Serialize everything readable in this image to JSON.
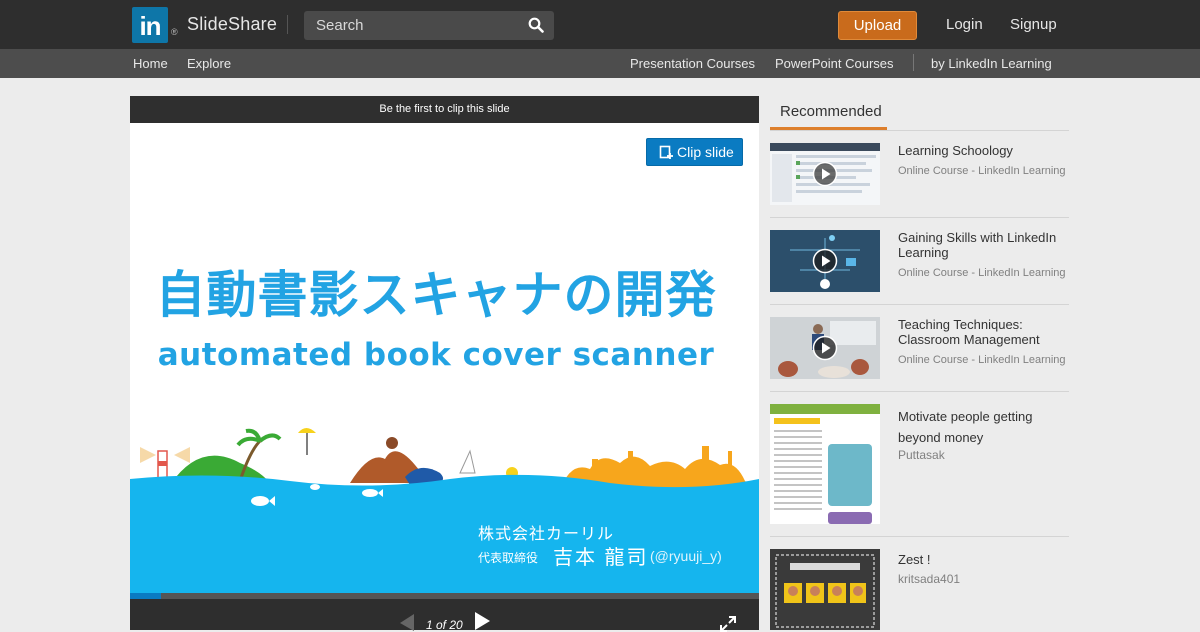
{
  "header": {
    "logo_mark": "in",
    "logo_reg": "®",
    "brand": "SlideShare",
    "search_placeholder": "Search",
    "upload": "Upload",
    "login": "Login",
    "signup": "Signup"
  },
  "nav": {
    "home": "Home",
    "explore": "Explore",
    "presentation_courses": "Presentation Courses",
    "powerpoint_courses": "PowerPoint Courses",
    "by_linkedin": "by LinkedIn Learning"
  },
  "player": {
    "clip_notice": "Be the first to clip this slide",
    "clip_button": "Clip slide",
    "slide": {
      "title_jp": "自動書影スキャナの開発",
      "title_en": "automated book cover scanner",
      "company": "株式会社カーリル",
      "rep_role": "代表取締役",
      "rep_name": "吉本 龍司",
      "rep_handle": "(@ryuuji_y)"
    },
    "progress": 0.05,
    "pager": "1 of 20"
  },
  "sidebar": {
    "tab": "Recommended",
    "items": [
      {
        "title": "Learning Schoology",
        "sub": "Online Course - LinkedIn Learning"
      },
      {
        "title": "Gaining Skills with LinkedIn Learning",
        "sub": "Online Course - LinkedIn Learning"
      },
      {
        "title": "Teaching Techniques: Classroom Management",
        "sub": "Online Course - LinkedIn Learning"
      },
      {
        "title": "Motivate people getting beyond money",
        "sub": "Puttasak"
      },
      {
        "title": "Zest !",
        "sub": "kritsada401"
      }
    ]
  },
  "colors": {
    "accent_blue": "#0a7bc2",
    "upload_orange": "#c96b1c",
    "tab_orange": "#dd7f2c",
    "slide_title_blue": "#22a3e3",
    "sea_blue": "#15b5ee"
  }
}
